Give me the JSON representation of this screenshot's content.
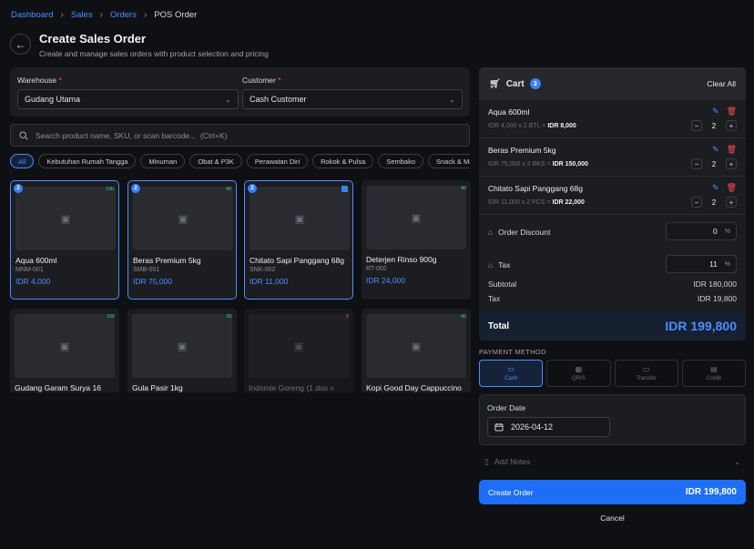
{
  "breadcrumb": {
    "items": [
      "Dashboard",
      "Sales",
      "Orders",
      "POS Order"
    ]
  },
  "header": {
    "title": "Create Sales Order",
    "subtitle": "Create and manage sales orders with product selection and pricing"
  },
  "form": {
    "warehouse_label": "Warehouse",
    "warehouse_value": "Gudang Utama",
    "customer_label": "Customer",
    "customer_value": "Cash Customer",
    "required_mark": "*"
  },
  "search": {
    "placeholder": "Search product name, SKU, or scan barcode...  (Ctrl+K)"
  },
  "categories": [
    "All",
    "Kebutuhan Rumah Tangga",
    "Minuman",
    "Obat & P3K",
    "Perawatan Diri",
    "Rokok & Pulsa",
    "Sembako",
    "Snack & Makanan"
  ],
  "products": [
    {
      "name": "Aqua 600ml",
      "sku": "MNM-001",
      "price": "IDR 4,000",
      "stock": "190",
      "badge": "2",
      "selected": true
    },
    {
      "name": "Beras Premium 5kg",
      "sku": "SMB-001",
      "price": "IDR 75,000",
      "stock": "48",
      "badge": "2",
      "selected": true
    },
    {
      "name": "Chitato Sapi Panggang 68g",
      "sku": "SNK-002",
      "price": "IDR 11,000",
      "stock": "98",
      "badge": "2",
      "selected": true
    },
    {
      "name": "Deterjen Rinso 900g",
      "sku": "RT-002",
      "price": "IDR 24,000",
      "stock": "40",
      "badge": "",
      "selected": false
    },
    {
      "name": "Gudang Garam Surya 16",
      "sku": "",
      "price": "",
      "stock": "100",
      "badge": "",
      "selected": false
    },
    {
      "name": "Gula Pasir 1kg",
      "sku": "",
      "price": "",
      "stock": "80",
      "badge": "",
      "selected": false
    },
    {
      "name": "Indomie Goreng (1 dus =",
      "sku": "",
      "price": "",
      "stock": "0",
      "badge": "",
      "selected": false,
      "disabled": true
    },
    {
      "name": "Kopi Good Day Cappuccino",
      "sku": "",
      "price": "",
      "stock": "40",
      "badge": "",
      "selected": false
    }
  ],
  "cart": {
    "title": "Cart",
    "count": "3",
    "clear_label": "Clear All",
    "items": [
      {
        "name": "Aqua 600ml",
        "calc": "IDR 4,000 x 2 BTL =",
        "subtotal": "IDR 8,000",
        "qty": "2"
      },
      {
        "name": "Beras Premium 5kg",
        "calc": "IDR 75,000 x 2 BKS =",
        "subtotal": "IDR 150,000",
        "qty": "2"
      },
      {
        "name": "Chitato Sapi Panggang 68g",
        "calc": "IDR 11,000 x 2 PCS =",
        "subtotal": "IDR 22,000",
        "qty": "2"
      }
    ],
    "order_discount_label": "Order Discount",
    "order_discount_value": "0",
    "tax_label": "Tax",
    "tax_value": "11",
    "percent_unit": "%",
    "subtotal_label": "Subtotal",
    "subtotal_value": "IDR 180,000",
    "tax_sum_label": "Tax",
    "tax_sum_value": "IDR 19,800",
    "total_label": "Total",
    "total_value": "IDR 199,800"
  },
  "payment": {
    "label": "PAYMENT METHOD",
    "methods": [
      "Cash",
      "QRIS",
      "Transfer",
      "Credit"
    ],
    "selected": "Cash"
  },
  "order_date": {
    "label": "Order Date",
    "value": "2026-04-12"
  },
  "notes": {
    "label": "Add Notes"
  },
  "actions": {
    "create_label": "Create Order",
    "create_value": "IDR 199,800",
    "cancel_label": "Cancel"
  },
  "colors": {
    "accent": "#4c8dff",
    "primary_button": "#1e6ef5",
    "danger": "#ff4d4d",
    "stock_ok": "#2fd08b",
    "background": "#0f1013"
  }
}
